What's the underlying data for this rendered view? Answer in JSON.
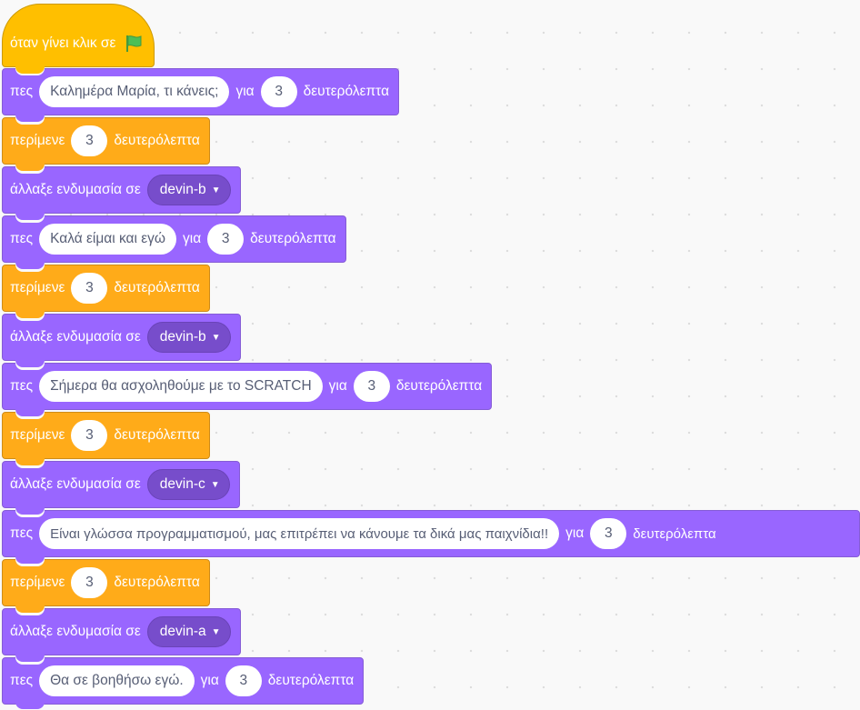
{
  "script": {
    "hat": {
      "label": "όταν γίνει κλικ σε",
      "flag_icon": "green-flag-icon",
      "color": "#ffbf00"
    },
    "colors": {
      "looks": "#9966ff",
      "control": "#ffab19",
      "dropdown": "#774dcb"
    },
    "blocks": [
      {
        "label": "πες",
        "message": "Καλημέρα  Μαρία, τι κάνεις;",
        "for_label": "για",
        "seconds": "3",
        "unit": "δευτερόλεπτα"
      },
      {
        "label": "περίμενε",
        "seconds": "3",
        "unit": "δευτερόλεπτα"
      },
      {
        "label": "άλλαξε ενδυμασία σε",
        "costume": "devin-b"
      },
      {
        "label": "πες",
        "message": "Καλά είμαι και εγώ",
        "for_label": "για",
        "seconds": "3",
        "unit": "δευτερόλεπτα"
      },
      {
        "label": "περίμενε",
        "seconds": "3",
        "unit": "δευτερόλεπτα"
      },
      {
        "label": "άλλαξε ενδυμασία σε",
        "costume": "devin-b"
      },
      {
        "label": "πες",
        "message": "Σήμερα θα ασχοληθούμε με το SCRATCH",
        "for_label": "για",
        "seconds": "3",
        "unit": "δευτερόλεπτα"
      },
      {
        "label": "περίμενε",
        "seconds": "3",
        "unit": "δευτερόλεπτα"
      },
      {
        "label": "άλλαξε ενδυμασία σε",
        "costume": "devin-c"
      },
      {
        "label": "πες",
        "message": "Είναι γλώσσα προγραμματισμού, μας επιτρέπει να κάνουμε τα δικά μας παιχνίδια!!",
        "for_label": "για",
        "seconds": "3",
        "unit": "δευτερόλεπτα"
      },
      {
        "label": "περίμενε",
        "seconds": "3",
        "unit": "δευτερόλεπτα"
      },
      {
        "label": "άλλαξε ενδυμασία σε",
        "costume": "devin-a"
      },
      {
        "label": "πες",
        "message": "Θα σε βοηθήσω εγώ.",
        "for_label": "για",
        "seconds": "3",
        "unit": "δευτερόλεπτα"
      }
    ]
  }
}
